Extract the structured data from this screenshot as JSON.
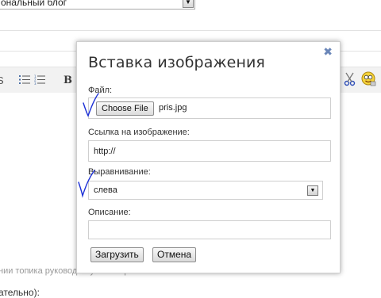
{
  "background": {
    "blog_select_value": "ональный блог",
    "toolbar": {
      "bold_label": "B"
    },
    "note_text": "нии топика руководствуйтесь правилами написания топиков",
    "note_text_2": "ательно):"
  },
  "modal": {
    "title": "Вставка изображения",
    "close_glyph": "✖",
    "file": {
      "label": "Файл:",
      "button_label": "Choose File",
      "filename": "pris.jpg"
    },
    "link": {
      "label": "Ссылка на изображение:",
      "value": "http://"
    },
    "align": {
      "label": "Выравнивание:",
      "value": "слева"
    },
    "description": {
      "label": "Описание:",
      "value": ""
    },
    "buttons": {
      "upload": "Загрузить",
      "cancel": "Отмена"
    }
  },
  "annotation_color": "#1b2fd6"
}
